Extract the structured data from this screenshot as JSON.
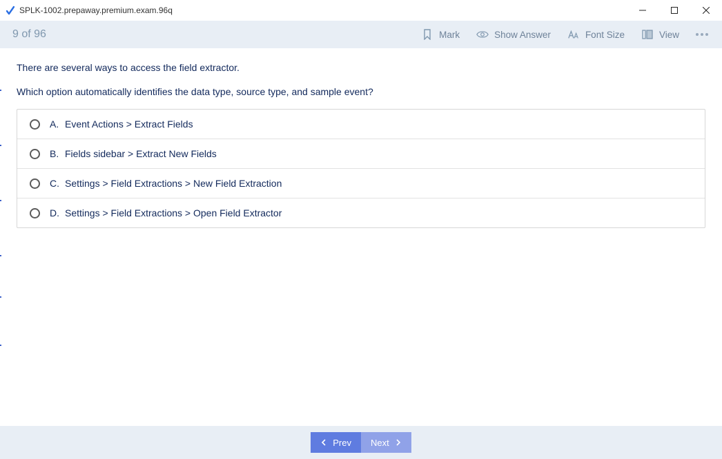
{
  "window": {
    "title": "SPLK-1002.prepaway.premium.exam.96q"
  },
  "toolbar": {
    "counter": "9 of 96",
    "mark": "Mark",
    "showAnswer": "Show Answer",
    "fontSize": "Font Size",
    "view": "View"
  },
  "question": {
    "line1": "There are several ways to access the field extractor.",
    "line2": "Which option automatically identifies the data type, source type, and sample event?"
  },
  "options": [
    {
      "letter": "A.",
      "text": "Event Actions > Extract Fields"
    },
    {
      "letter": "B.",
      "text": "Fields sidebar > Extract New Fields"
    },
    {
      "letter": "C.",
      "text": "Settings > Field Extractions > New Field Extraction"
    },
    {
      "letter": "D.",
      "text": "Settings > Field Extractions > Open Field Extractor"
    }
  ],
  "footer": {
    "prev": "Prev",
    "next": "Next"
  }
}
